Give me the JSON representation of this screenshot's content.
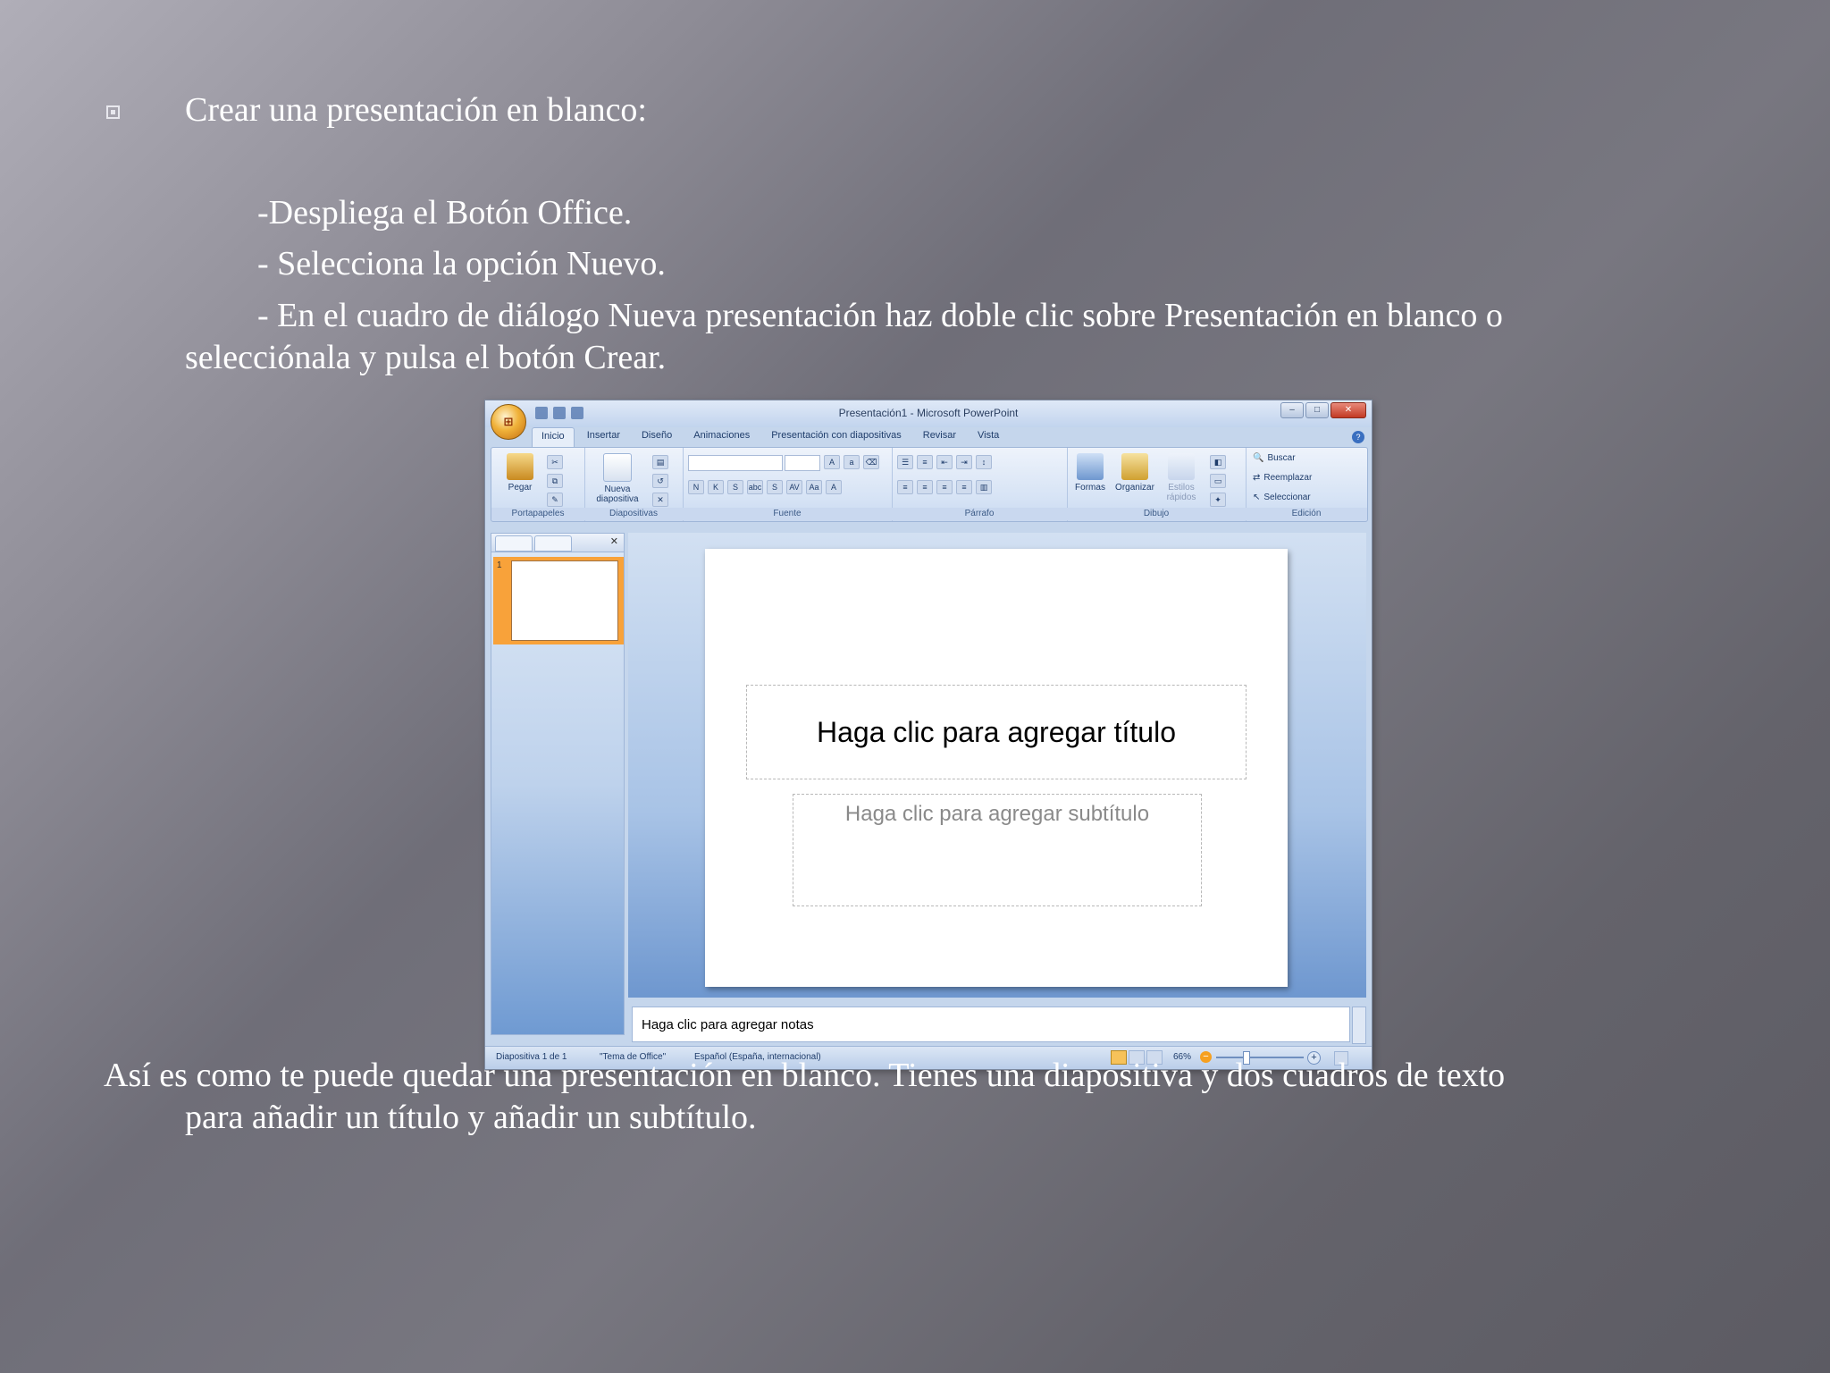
{
  "slide": {
    "bullet": "Crear una presentación en blanco:",
    "step1": "-Despliega el Botón Office.",
    "step2": "- Selecciona la opción Nuevo.",
    "step3_line1": "- En el cuadro de diálogo Nueva presentación haz doble clic sobre Presentación en blanco o",
    "step3_line2": "selecciónala y pulsa el botón Crear.",
    "footer_line1": "Así es como te puede quedar una presentación en blanco. Tienes una diapositiva y dos cuadros de texto",
    "footer_line2": "para añadir un título y añadir un subtítulo."
  },
  "screenshot": {
    "window_title": "Presentación1 - Microsoft PowerPoint",
    "office_button": "⊞",
    "tabs": [
      "Inicio",
      "Insertar",
      "Diseño",
      "Animaciones",
      "Presentación con diapositivas",
      "Revisar",
      "Vista"
    ],
    "ribbon": {
      "portapapeles": {
        "label": "Portapapeles",
        "pegar": "Pegar"
      },
      "diapositivas": {
        "label": "Diapositivas",
        "nueva": "Nueva",
        "nueva2": "diapositiva"
      },
      "fuente": {
        "label": "Fuente",
        "buttons": [
          "N",
          "K",
          "S",
          "abc",
          "S",
          "AV",
          "Aa",
          "A"
        ]
      },
      "parrafo": {
        "label": "Párrafo"
      },
      "dibujo": {
        "label": "Dibujo",
        "formas": "Formas",
        "organizar": "Organizar",
        "estilos": "Estilos",
        "estilos2": "rápidos"
      },
      "edicion": {
        "label": "Edición",
        "buscar": "Buscar",
        "reemplazar": "Reemplazar",
        "seleccionar": "Seleccionar"
      }
    },
    "thumbnail_number": "1",
    "title_placeholder": "Haga clic para agregar título",
    "subtitle_placeholder": "Haga clic para agregar subtítulo",
    "notes_placeholder": "Haga clic para agregar notas",
    "status": {
      "slide": "Diapositiva 1 de 1",
      "theme": "\"Tema de Office\"",
      "language": "Español (España, internacional)",
      "zoom": "66%"
    }
  },
  "colors": {
    "background_light": "#b0aeb8",
    "background_dark": "#5c5b63",
    "text": "#ffffff",
    "ribbon_blue": "#c5d6ec",
    "selection_orange": "#f8a23a"
  }
}
